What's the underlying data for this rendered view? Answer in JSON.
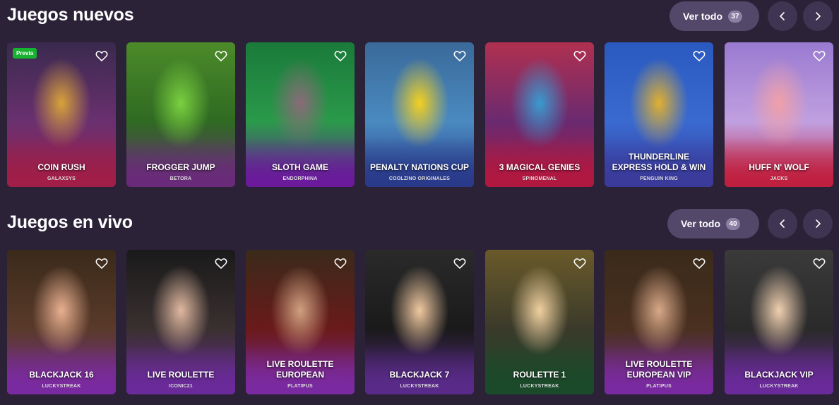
{
  "new_games": {
    "title": "Juegos nuevos",
    "see_all_label": "Ver todo",
    "count": "37",
    "games": [
      {
        "name": "COIN RUSH",
        "provider": "GALAXSYS",
        "badge": "Previa",
        "bg_top": "#3a2a4e",
        "bg_mid": "#6a3070",
        "bg_bottom": "#a01e48",
        "accent": "#d8a23a"
      },
      {
        "name": "FROGGER JUMP",
        "provider": "BETORA",
        "bg_top": "#4c8a2a",
        "bg_mid": "#2f6a22",
        "bg_bottom": "#6a2a7a",
        "accent": "#7ad040"
      },
      {
        "name": "SLOTH GAME",
        "provider": "ENDORPHINA",
        "bg_top": "#1a7a3a",
        "bg_mid": "#2a9a4a",
        "bg_bottom": "#6a1a9a",
        "accent": "#8a6a78"
      },
      {
        "name": "PENALTY NATIONS CUP",
        "provider": "COOLZINO ORIGINALES",
        "bg_top": "#3a6a9a",
        "bg_mid": "#4a8ac0",
        "bg_bottom": "#2a3a8a",
        "accent": "#f4d020"
      },
      {
        "name": "3 MAGICAL GENIES",
        "provider": "SPINOMENAL",
        "bg_top": "#b03050",
        "bg_mid": "#6a2a70",
        "bg_bottom": "#b01840",
        "accent": "#3a9ad0"
      },
      {
        "name": "THUNDERLINE EXPRESS HOLD & WIN",
        "provider": "PENGUIN KING",
        "bg_top": "#2a5ac0",
        "bg_mid": "#3a6ad0",
        "bg_bottom": "#3a3a9a",
        "accent": "#e0b030"
      },
      {
        "name": "HUFF N' WOLF",
        "provider": "JACKS",
        "bg_top": "#9a7ad0",
        "bg_mid": "#c0a0e0",
        "bg_bottom": "#c02040",
        "accent": "#f0a0a8"
      }
    ]
  },
  "live_games": {
    "title": "Juegos en vivo",
    "see_all_label": "Ver todo",
    "count": "40",
    "games": [
      {
        "name": "BLACKJACK 16",
        "provider": "LUCKYSTREAK",
        "bg_top": "#3a2a1a",
        "bg_mid": "#5a3a2a",
        "bg_bottom": "#7a2aa0",
        "accent": "#e8b090"
      },
      {
        "name": "LIVE ROULETTE",
        "provider": "ICONIC21",
        "bg_top": "#1a1a1a",
        "bg_mid": "#3a3030",
        "bg_bottom": "#6a2a9a",
        "accent": "#e0b8a0"
      },
      {
        "name": "LIVE ROULETTE EUROPEAN",
        "provider": "PLATIPUS",
        "bg_top": "#3a2a1a",
        "bg_mid": "#6a1a1a",
        "bg_bottom": "#7a2aa0",
        "accent": "#d0a080"
      },
      {
        "name": "BLACKJACK 7",
        "provider": "LUCKYSTREAK",
        "bg_top": "#2a2a2a",
        "bg_mid": "#1a1a1a",
        "bg_bottom": "#5a2a8a",
        "accent": "#f0c8a0"
      },
      {
        "name": "ROULETTE 1",
        "provider": "LUCKYSTREAK",
        "bg_top": "#6a5a2a",
        "bg_mid": "#3a3a2a",
        "bg_bottom": "#1a4a2a",
        "accent": "#f0d0a0"
      },
      {
        "name": "LIVE ROULETTE EUROPEAN VIP",
        "provider": "PLATIPUS",
        "bg_top": "#3a2a1a",
        "bg_mid": "#4a3020",
        "bg_bottom": "#7a2aa0",
        "accent": "#d8a888"
      },
      {
        "name": "BLACKJACK VIP",
        "provider": "LUCKYSTREAK",
        "bg_top": "#3a3a3a",
        "bg_mid": "#2a2a2a",
        "bg_bottom": "#6a2a9a",
        "accent": "#f0d0b0"
      }
    ]
  }
}
